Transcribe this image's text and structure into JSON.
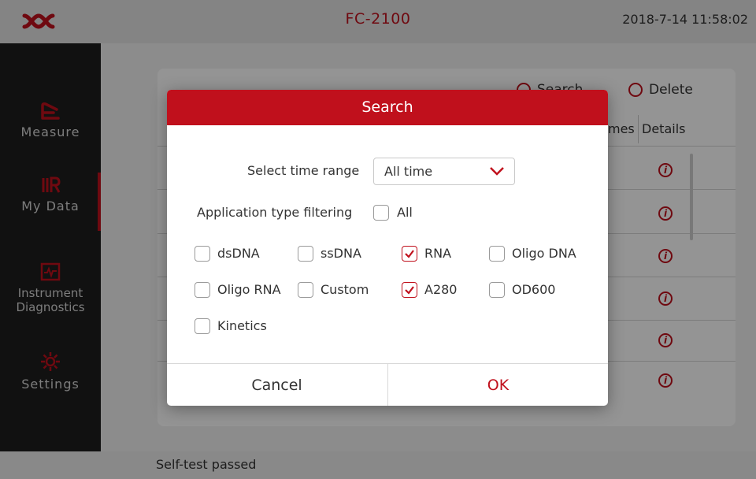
{
  "app": {
    "title": "FC-2100",
    "datetime": "2018-7-14  11:58:02"
  },
  "sidebar": {
    "items": [
      {
        "label": "Measure",
        "icon": "measure-icon"
      },
      {
        "label": "My Data",
        "icon": "my-data-icon",
        "active": true
      },
      {
        "label": "Instrument Diagnostics",
        "icon": "diagnostics-icon"
      },
      {
        "label": "Settings",
        "icon": "settings-gear-icon"
      }
    ]
  },
  "toolbar": {
    "search_label": "Search",
    "delete_label": "Delete"
  },
  "table": {
    "columns": [
      "mes",
      "Details"
    ]
  },
  "status": {
    "text": "Self-test passed"
  },
  "dialog": {
    "title": "Search",
    "time_range_label": "Select time range",
    "time_range_value": "All time",
    "app_type_label": "Application type filtering",
    "all_label": "All",
    "all_checked": false,
    "options": [
      {
        "label": "dsDNA",
        "checked": false
      },
      {
        "label": "ssDNA",
        "checked": false
      },
      {
        "label": "RNA",
        "checked": true
      },
      {
        "label": "Oligo DNA",
        "checked": false
      },
      {
        "label": "Oligo RNA",
        "checked": false
      },
      {
        "label": "Custom",
        "checked": false
      },
      {
        "label": "A280",
        "checked": true
      },
      {
        "label": "OD600",
        "checked": false
      },
      {
        "label": "Kinetics",
        "checked": false
      }
    ],
    "cancel_label": "Cancel",
    "ok_label": "OK"
  },
  "colors": {
    "accent": "#c0101c",
    "sidebar": "#1e1e1e"
  }
}
